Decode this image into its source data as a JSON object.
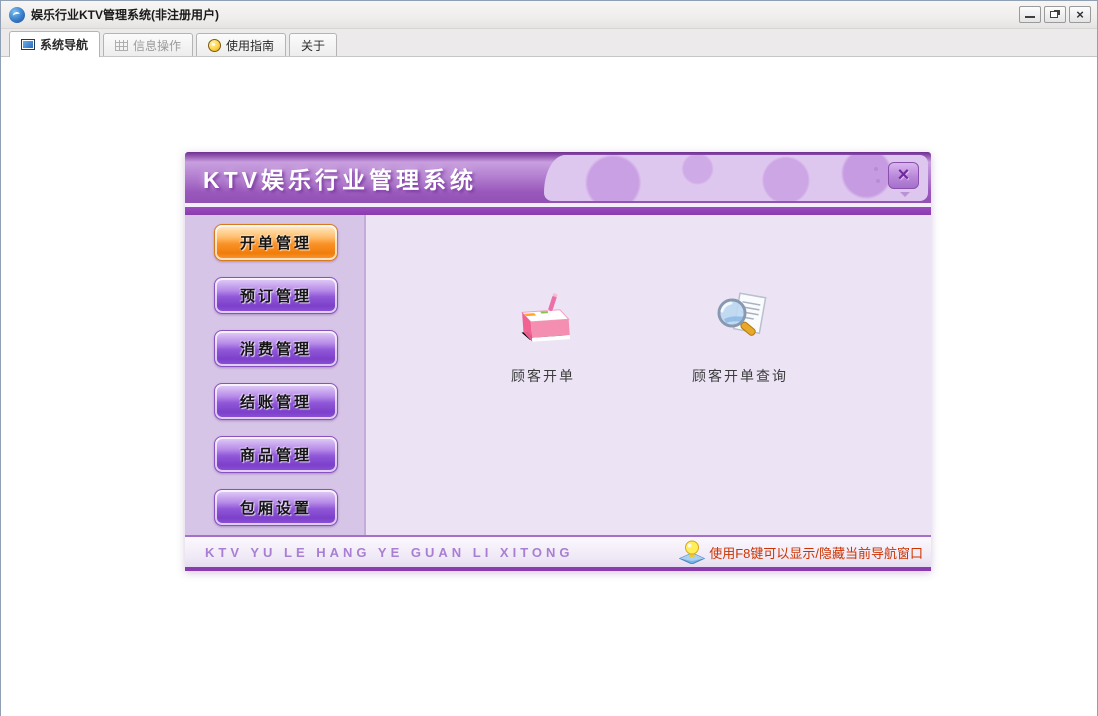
{
  "window": {
    "title": "娱乐行业KTV管理系统(非注册用户)",
    "close_glyph": "×"
  },
  "tabs": [
    {
      "label": "系统导航",
      "icon": "monitor-icon",
      "state": "active"
    },
    {
      "label": "信息操作",
      "icon": "grid-icon",
      "state": "disabled"
    },
    {
      "label": "使用指南",
      "icon": "help-coin-icon",
      "state": "normal"
    },
    {
      "label": "关于",
      "icon": "none",
      "state": "normal"
    }
  ],
  "dialog": {
    "title": "KTV娱乐行业管理系统",
    "close_glyph": "×",
    "sidebar_buttons": [
      {
        "label": "开单管理",
        "state": "active-orange"
      },
      {
        "label": "预订管理",
        "state": "normal"
      },
      {
        "label": "消费管理",
        "state": "normal"
      },
      {
        "label": "结账管理",
        "state": "normal"
      },
      {
        "label": "商品管理",
        "state": "normal"
      },
      {
        "label": "包厢设置",
        "state": "normal"
      }
    ],
    "shortcuts": [
      {
        "label": "顾客开单",
        "icon": "order-pad-icon"
      },
      {
        "label": "顾客开单查询",
        "icon": "search-document-icon"
      }
    ],
    "footer": {
      "left_text": "KTV YU LE HANG YE GUAN LI XITONG",
      "right_text": "使用F8键可以显示/隐藏当前导航窗口",
      "right_icon": "lightbulb-icon"
    }
  },
  "colors": {
    "header_purple": "#9a58bc",
    "strip_purple": "#8a3cae",
    "sidebar_bg": "#d7c5e7",
    "content_bg": "#ece4f5",
    "button_purple": "#8848d0",
    "active_button_orange": "#f78c1e",
    "footer_text_purple": "#a87fd2",
    "hint_text_red": "#cc3300"
  }
}
